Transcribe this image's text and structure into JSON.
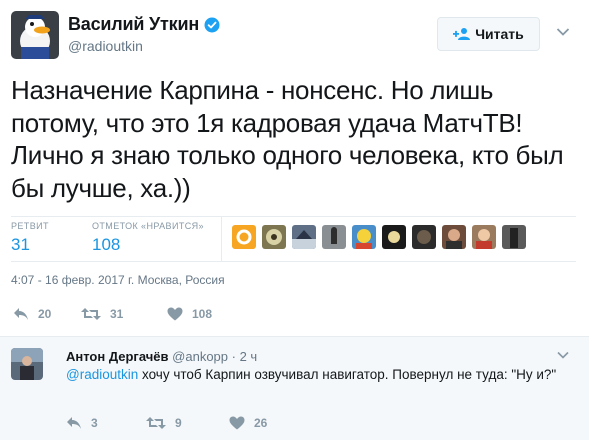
{
  "tweet": {
    "author_name": "Василий Уткин",
    "author_handle": "@radioutkin",
    "follow_label": "Читать",
    "text": "Назначение Карпина - нонсенс. Но лишь потому, что это 1я кадровая удача МатчТВ! Лично я знаю только одного человека, кто был бы лучше, ха.))",
    "stats": {
      "retweets_label": "РЕТВИТ",
      "retweets_value": "31",
      "likes_label": "ОТМЕТОК «НРАВИТСЯ»",
      "likes_value": "108"
    },
    "likers_count": 10,
    "timestamp": "4:07 - 16 февр. 2017 г.",
    "location": "Москва, Россия",
    "actions": {
      "reply": "20",
      "retweet": "31",
      "like": "108"
    }
  },
  "reply": {
    "author_name": "Антон Дергачёв",
    "author_handle": "@ankopp",
    "time": "· 2 ч",
    "mention": "@radioutkin",
    "text": " хочу чтоб Карпин озвучивал навигатор. Повернул не туда: \"Ну и?\"",
    "actions": {
      "reply": "3",
      "retweet": "9",
      "like": "26"
    }
  },
  "colors": {
    "link": "#1b95e0",
    "verified": "#1da1f2",
    "muted": "#657786"
  }
}
